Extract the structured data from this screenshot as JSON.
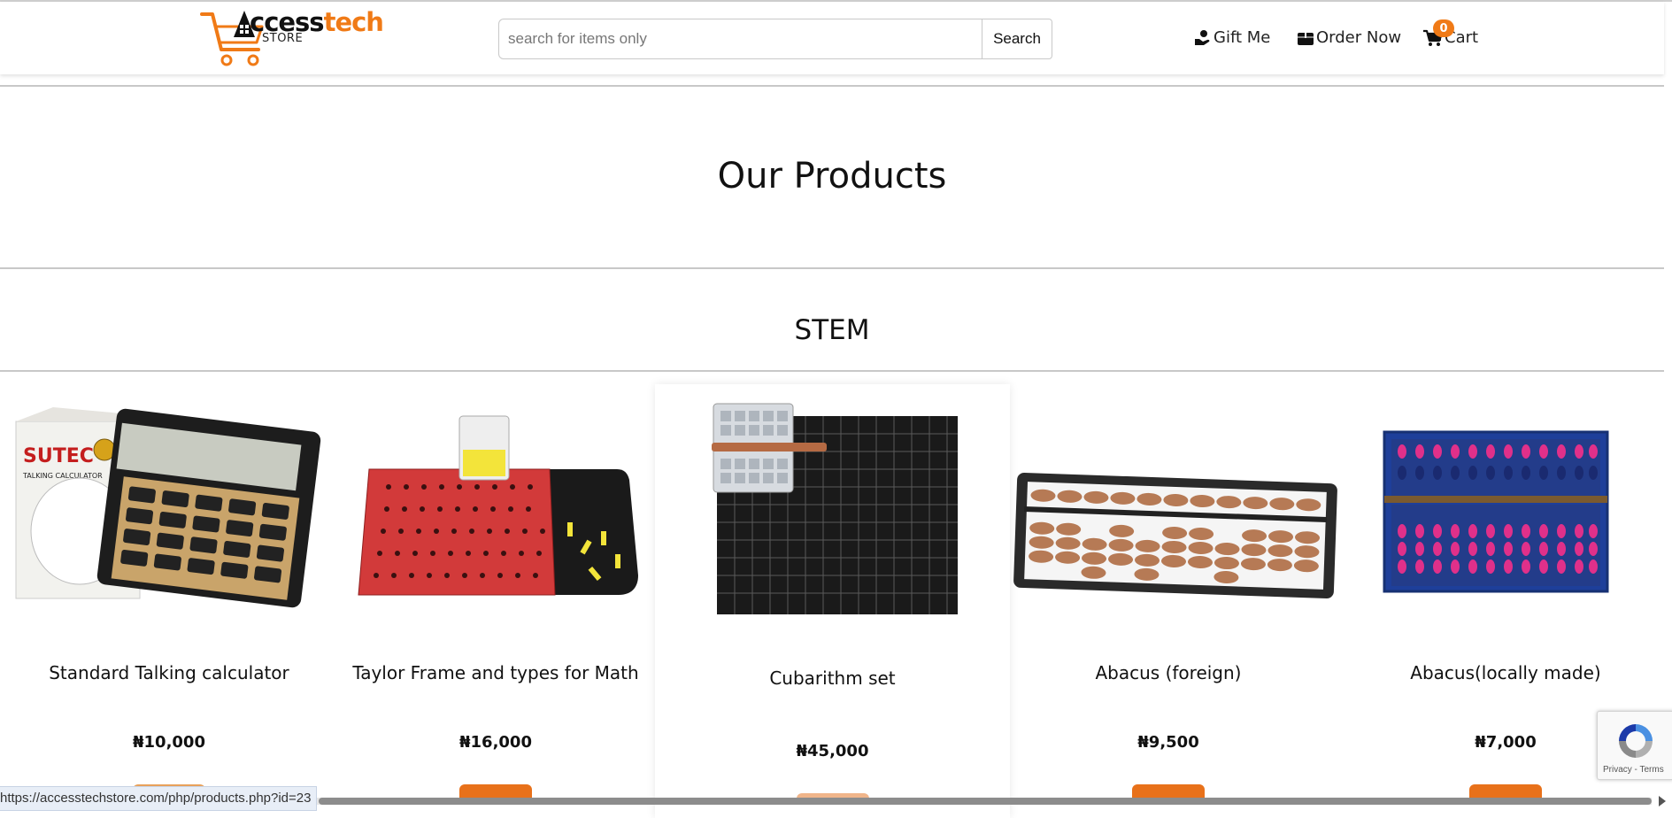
{
  "header": {
    "logo_brand": "Accesstech",
    "logo_brand_a": "A",
    "logo_brand_rest_dark": "ccess",
    "logo_brand_rest_orange": "tech",
    "logo_store": "STORE",
    "search": {
      "placeholder": "search for items only",
      "button_label": "Search"
    },
    "nav": {
      "gift": "Gift Me",
      "order": "Order Now",
      "cart": "Cart",
      "cart_count": "0"
    }
  },
  "main": {
    "title": "Our Products",
    "category": "STEM",
    "products": [
      {
        "name": "Standard Talking calculator",
        "price": "₦10,000"
      },
      {
        "name": "Taylor Frame and types for Math",
        "price": "₦16,000"
      },
      {
        "name": "Cubarithm set",
        "price": "₦45,000"
      },
      {
        "name": "Abacus (foreign)",
        "price": "₦9,500"
      },
      {
        "name": "Abacus(locally made)",
        "price": "₦7,000"
      }
    ]
  },
  "status_bar": {
    "url": "https://accesstechstore.com/php/products.php?id=23"
  },
  "recaptcha": {
    "links": "Privacy - Terms"
  },
  "colors": {
    "accent": "#f07a16",
    "button": "#e8711a"
  }
}
